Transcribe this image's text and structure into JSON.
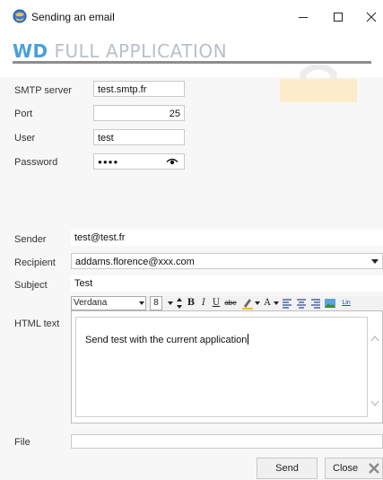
{
  "window": {
    "title": "Sending an email"
  },
  "header": {
    "logo_bold": "WD",
    "logo_rest": " FULL APPLICATION"
  },
  "smtp": {
    "server_label": "SMTP server",
    "server_value": "test.smtp.fr",
    "port_label": "Port",
    "port_value": "25",
    "user_label": "User",
    "user_value": "test",
    "password_label": "Password",
    "password_value": "●●●●"
  },
  "mail": {
    "sender_label": "Sender",
    "sender_value": "test@test.fr",
    "recipient_label": "Recipient",
    "recipient_value": "addams.florence@xxx.com",
    "subject_label": "Subject",
    "subject_value": "Test",
    "html_label": "HTML text",
    "html_value": "Send test with the current application",
    "file_label": "File",
    "file_value": ""
  },
  "editor_toolbar": {
    "font": "Verdana",
    "size": "8",
    "bold": "B",
    "italic": "I",
    "underline": "U",
    "strike": "abe",
    "font_color": "A",
    "link": "Lin"
  },
  "buttons": {
    "send": "Send",
    "close": "Close"
  },
  "icons": {
    "app": "globe-icon",
    "minimize": "minimize-icon",
    "maximize": "maximize-icon",
    "close": "close-icon",
    "eye": "eye-icon",
    "dropdown": "chevron-down-icon"
  }
}
